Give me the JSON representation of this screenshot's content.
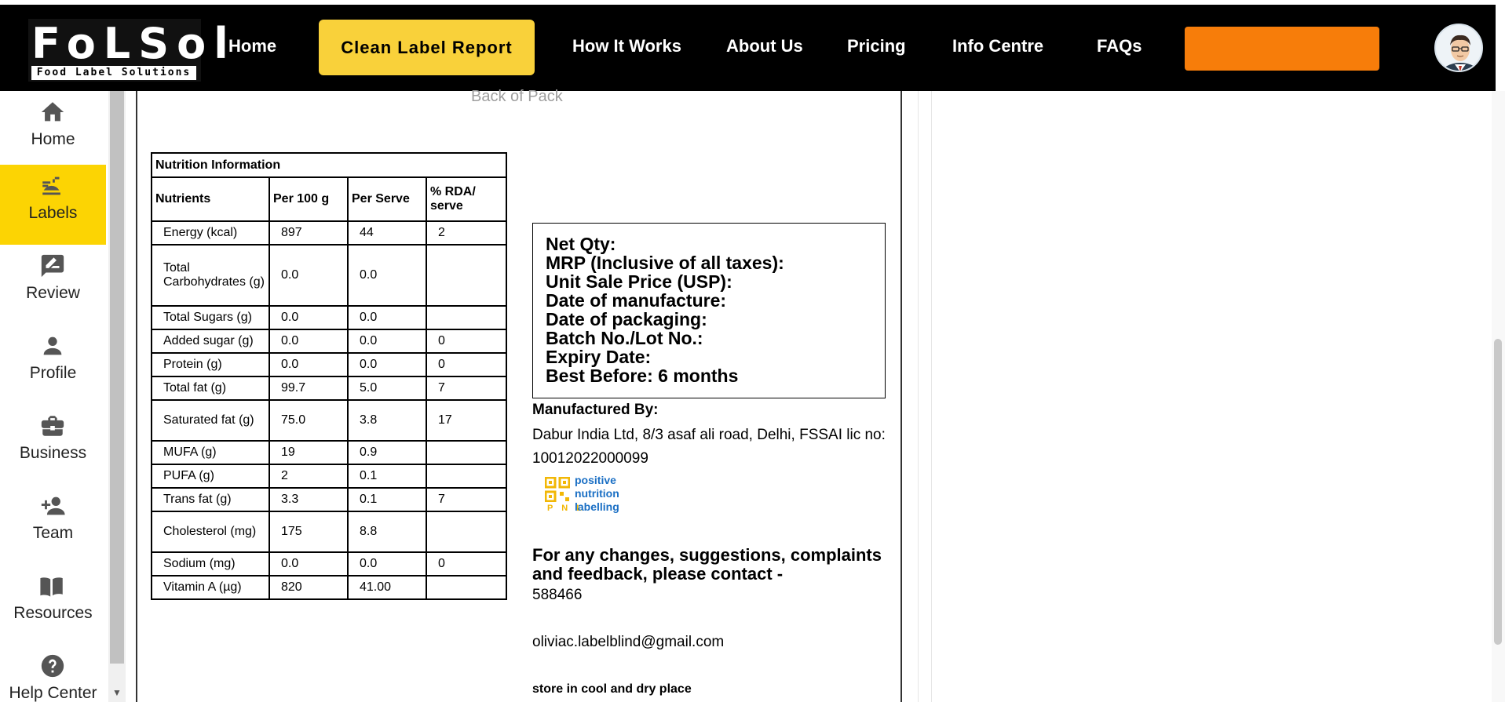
{
  "brand": {
    "logo_text": "FoLSol",
    "logo_subtext": "Food Label Solutions"
  },
  "nav": {
    "items": [
      {
        "label": "Home"
      },
      {
        "label": "Clean Label Report"
      },
      {
        "label": "How It Works"
      },
      {
        "label": "About Us"
      },
      {
        "label": "Pricing"
      },
      {
        "label": "Info Centre"
      },
      {
        "label": "FAQs"
      }
    ],
    "active_index": 1,
    "colors": {
      "bar": "#000000",
      "active": "#f9d13a",
      "cta": "#f77d0a"
    }
  },
  "sidebar": {
    "items": [
      {
        "label": "Home",
        "icon": "home-icon"
      },
      {
        "label": "Labels",
        "icon": "labels-icon"
      },
      {
        "label": "Review",
        "icon": "review-icon"
      },
      {
        "label": "Profile",
        "icon": "profile-icon"
      },
      {
        "label": "Business",
        "icon": "business-icon"
      },
      {
        "label": "Team",
        "icon": "team-icon"
      },
      {
        "label": "Resources",
        "icon": "resources-icon"
      },
      {
        "label": "Help Center",
        "icon": "help-icon"
      }
    ],
    "active_index": 1,
    "active_color": "#fcd403"
  },
  "label": {
    "section_title": "Back of Pack",
    "nutrition": {
      "title": "Nutrition Information",
      "headers": [
        "Nutrients",
        "Per 100 g",
        "Per Serve",
        "% RDA/ serve"
      ],
      "rows": [
        [
          "Energy (kcal)",
          "897",
          "44",
          "2"
        ],
        [
          "Total Carbohydrates (g)",
          "0.0",
          "0.0",
          ""
        ],
        [
          "Total Sugars (g)",
          "0.0",
          "0.0",
          ""
        ],
        [
          "Added sugar (g)",
          "0.0",
          "0.0",
          "0"
        ],
        [
          "Protein (g)",
          "0.0",
          "0.0",
          "0"
        ],
        [
          "Total fat (g)",
          "99.7",
          "5.0",
          "7"
        ],
        [
          "Saturated fat (g)",
          "75.0",
          "3.8",
          "17"
        ],
        [
          "MUFA (g)",
          "19",
          "0.9",
          ""
        ],
        [
          "PUFA (g)",
          "2",
          "0.1",
          ""
        ],
        [
          "Trans fat (g)",
          "3.3",
          "0.1",
          "7"
        ],
        [
          "Cholesterol (mg)",
          "175",
          "8.8",
          ""
        ],
        [
          "Sodium (mg)",
          "0.0",
          "0.0",
          "0"
        ],
        [
          "Vitamin A (µg)",
          "820",
          "41.00",
          ""
        ]
      ]
    },
    "declarations": [
      "Net Qty:",
      "MRP (Inclusive of all taxes):",
      "Unit Sale Price (USP):",
      "Date of manufacture:",
      "Date of packaging:",
      "Batch No./Lot No.:",
      "Expiry Date:",
      "Best Before: 6 months"
    ],
    "manufacturer_heading": "Manufactured By:",
    "manufacturer_text": "Dabur India Ltd, 8/3 asaf ali road, Delhi, FSSAI lic no: 10012022000099",
    "pnl": {
      "letters": "P N L",
      "words": [
        "positive",
        "nutrition",
        "labelling"
      ]
    },
    "contact_heading": "For any changes, suggestions, complaints and feedback, please contact -",
    "phone": "588466",
    "email": "oliviac.labelblind@gmail.com",
    "storage": "store in cool and dry place"
  }
}
